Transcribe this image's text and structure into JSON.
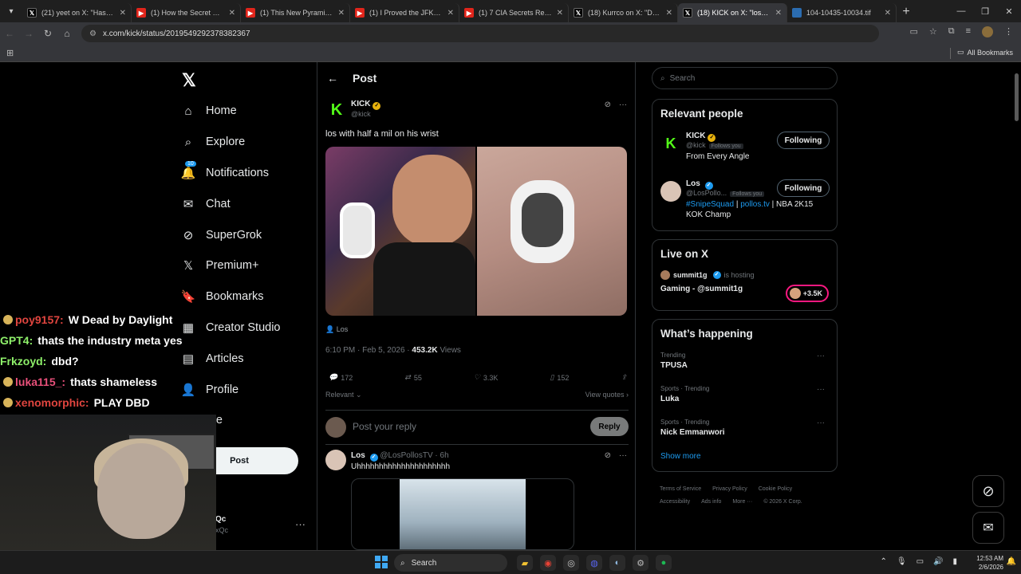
{
  "browser": {
    "tabs": [
      {
        "title": "(21) yeet on X: \"Hasan ge",
        "favicon": "x"
      },
      {
        "title": "(1) How the Secret Servic",
        "favicon": "yt"
      },
      {
        "title": "(1) This New Pyramid The",
        "favicon": "yt"
      },
      {
        "title": "(1) I Proved the JFK Consp",
        "favicon": "yt"
      },
      {
        "title": "(1) 7 CIA Secrets Revealed",
        "favicon": "yt"
      },
      {
        "title": "(18) Kurrco on X: \"DRAKE",
        "favicon": "x"
      },
      {
        "title": "(18) KICK on X: \"los with h",
        "favicon": "x"
      },
      {
        "title": "104-10435-10034.tif",
        "favicon": "doc"
      }
    ],
    "url": "x.com/kick/status/2019549292378382367",
    "bookmarks_label": "All Bookmarks"
  },
  "nav": {
    "items": [
      {
        "label": "Home",
        "icon": "home-icon"
      },
      {
        "label": "Explore",
        "icon": "search-icon"
      },
      {
        "label": "Notifications",
        "icon": "bell-icon",
        "badge": "10"
      },
      {
        "label": "Chat",
        "icon": "mail-icon"
      },
      {
        "label": "SuperGrok",
        "icon": "grok-icon"
      },
      {
        "label": "Premium+",
        "icon": "x-icon"
      },
      {
        "label": "Bookmarks",
        "icon": "bookmark-icon"
      },
      {
        "label": "Creator Studio",
        "icon": "studio-icon"
      },
      {
        "label": "Articles",
        "icon": "article-icon"
      },
      {
        "label": "Profile",
        "icon": "person-icon"
      },
      {
        "label": "ore",
        "icon": "more-icon"
      }
    ],
    "post_label": "Post",
    "account": {
      "name": "Qc",
      "handle": "xQc"
    }
  },
  "main": {
    "header_title": "Post",
    "tweet": {
      "name": "KICK",
      "handle": "@kick",
      "text": "los with half a mil on his wrist",
      "tagged": "Los",
      "time": "6:10 PM · Feb 5, 2026 ·",
      "views_count": "453.2K",
      "views_label": "Views",
      "stats": {
        "replies": "172",
        "reposts": "55",
        "likes": "3.3K",
        "bookmarks": "152"
      }
    },
    "relevant_label": "Relevant",
    "view_quotes_label": "View quotes",
    "reply_placeholder": "Post your reply",
    "reply_button": "Reply",
    "reply": {
      "name": "Los",
      "handle": "@LosPollosTV · 6h",
      "text": "Uhhhhhhhhhhhhhhhhhhhhh"
    }
  },
  "right": {
    "search_placeholder": "Search",
    "relevant_people": {
      "title": "Relevant people",
      "people": [
        {
          "name": "KICK",
          "handle": "@kick",
          "follows_you": "Follows you",
          "bio": "From Every Angle",
          "button": "Following"
        },
        {
          "name": "Los",
          "handle": "@LosPollo...",
          "follows_you": "Follows you",
          "bio_link1": "#SnipeSquad",
          "bio_mid": " | ",
          "bio_link2": "pollos.tv",
          "bio_end": " | NBA 2K15",
          "bio_line2": "KOK Champ",
          "button": "Following"
        }
      ]
    },
    "live": {
      "title": "Live on X",
      "host": "summit1g",
      "hosting": "is hosting",
      "stream_title": "Gaming - @summit1g",
      "listeners": "+3.5K"
    },
    "happening": {
      "title": "What’s happening",
      "trends": [
        {
          "context": "Trending",
          "name": "TPUSA"
        },
        {
          "context": "Sports · Trending",
          "name": "Luka"
        },
        {
          "context": "Sports · Trending",
          "name": "Nick Emmanwori"
        }
      ],
      "show_more": "Show more"
    },
    "footer": [
      "Terms of Service",
      "Privacy Policy",
      "Cookie Policy",
      "Accessibility",
      "Ads info",
      "More ···",
      "© 2026 X Corp."
    ]
  },
  "chat_overlay": [
    {
      "user": "poy9157:",
      "user_color": "#e0453f",
      "msg": "W  Dead by Daylight"
    },
    {
      "user": "GPT4:",
      "user_color": "#8ef06a",
      "msg": "thats the industry meta yes"
    },
    {
      "user": "Frkzoyd:",
      "user_color": "#8ef06a",
      "msg": "dbd?"
    },
    {
      "user": "luka115_:",
      "user_color": "#e8507a",
      "msg": "thats shameless"
    },
    {
      "user": "xenomorphic:",
      "user_color": "#e0453f",
      "msg": "PLAY DBD"
    }
  ],
  "taskbar": {
    "search_label": "Search",
    "time": "12:53 AM",
    "date": "2/6/2026"
  }
}
